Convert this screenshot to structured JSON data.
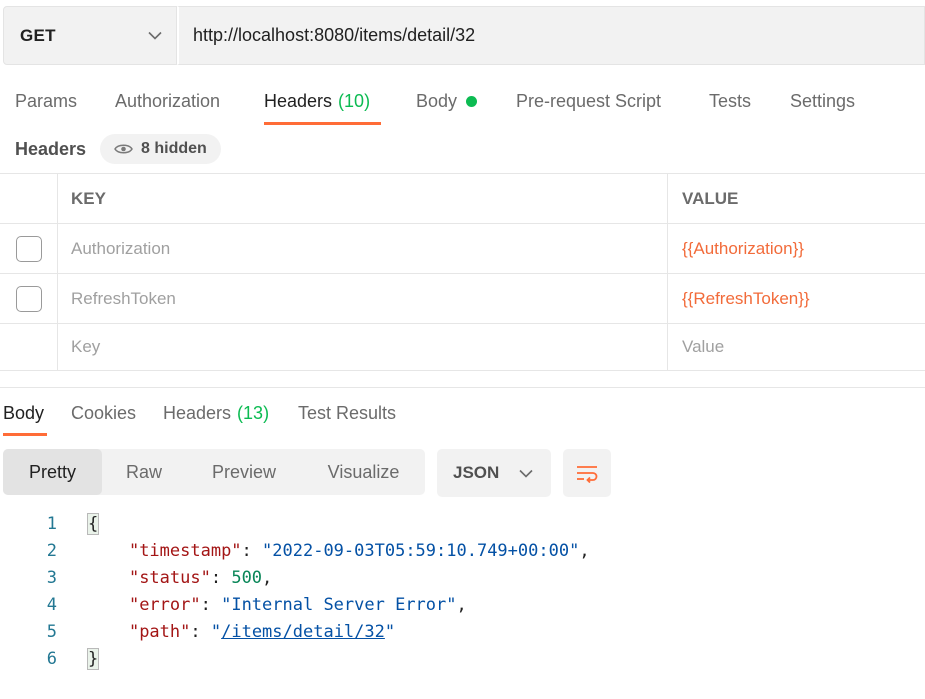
{
  "request": {
    "method": "GET",
    "url": "http://localhost:8080/items/detail/32"
  },
  "request_tabs": [
    {
      "label": "Params"
    },
    {
      "label": "Authorization"
    },
    {
      "label": "Headers",
      "count": "(10)"
    },
    {
      "label": "Body"
    },
    {
      "label": "Pre-request Script"
    },
    {
      "label": "Tests"
    },
    {
      "label": "Settings"
    }
  ],
  "headers_section": {
    "title": "Headers",
    "hidden_label": "8 hidden",
    "columns": {
      "key": "KEY",
      "value": "VALUE"
    },
    "rows": [
      {
        "key": "Authorization",
        "value": "{{Authorization}}"
      },
      {
        "key": "RefreshToken",
        "value": "{{RefreshToken}}"
      }
    ],
    "placeholder": {
      "key": "Key",
      "value": "Value"
    }
  },
  "response_tabs": [
    {
      "label": "Body"
    },
    {
      "label": "Cookies"
    },
    {
      "label": "Headers",
      "count": "(13)"
    },
    {
      "label": "Test Results"
    }
  ],
  "view_modes": [
    "Pretty",
    "Raw",
    "Preview",
    "Visualize"
  ],
  "format": "JSON",
  "code": {
    "line_numbers": [
      "1",
      "2",
      "3",
      "4",
      "5",
      "6"
    ],
    "open_brace": "{",
    "close_brace": "}",
    "timestamp_key": "\"timestamp\"",
    "timestamp_value": "\"2022-09-03T05:59:10.749+00:00\"",
    "status_key": "\"status\"",
    "status_value": "500",
    "error_key": "\"error\"",
    "error_value": "\"Internal Server Error\"",
    "path_key": "\"path\"",
    "path_value_open": "\"",
    "path_value_link": "/items/detail/32",
    "path_value_close": "\""
  },
  "colors": {
    "accent": "#ff6c37",
    "count_green": "#0cbb52",
    "variable": "#f26b3a",
    "json_key": "#a31515",
    "json_string": "#0451a5",
    "json_number": "#098658"
  }
}
